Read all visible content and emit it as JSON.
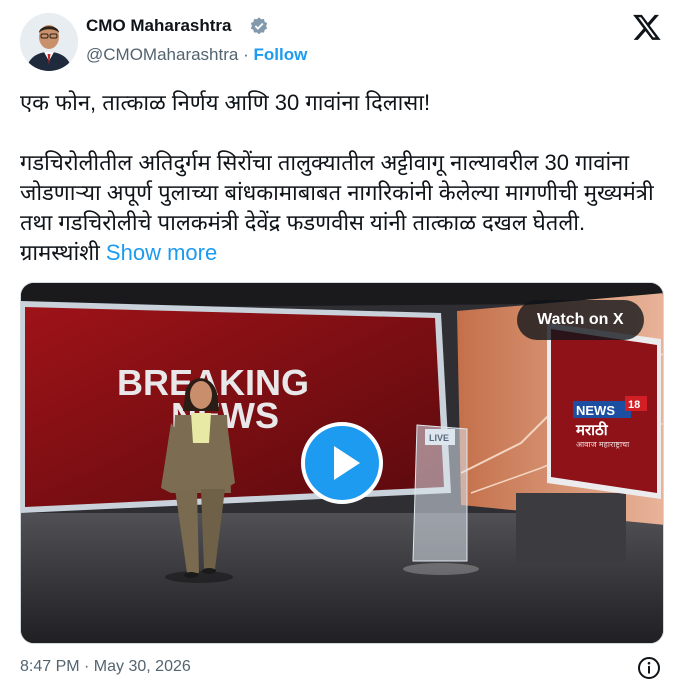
{
  "author": {
    "name": "CMO Maharashtra",
    "handle": "@CMOMaharashtra",
    "separator": "·",
    "follow_label": "Follow",
    "avatar_icon": "person-avatar",
    "verified_icon": "verified-badge-icon"
  },
  "tweet": {
    "text": "एक फोन, तात्काळ निर्णय आणि 30 गावांना दिलासा!\n\nगडचिरोलीतील अतिदुर्गम सिरोंचा तालुक्यातील अट्टीवागू नाल्यावरील 30 गावांना जोडणाऱ्या अपूर्ण पुलाच्या बांधकामाबाबत नागरिकांनी केलेल्या मागणीची मुख्यमंत्री तथा गडचिरोलीचे पालकमंत्री देवेंद्र फडणवीस यांनी तात्काळ दखल घेतली. ग्रामस्थांशी",
    "show_more_label": "Show more"
  },
  "media": {
    "watch_label": "Watch on X",
    "screen_line1": "BREAKING",
    "screen_line2": "NEWS",
    "channel_name": "NEWS",
    "channel_number": "18",
    "channel_language": "मराठी",
    "channel_tagline": "आवाज महाराष्ट्राचा",
    "podium_label": "LIVE",
    "play_icon": "play-icon"
  },
  "footer": {
    "timestamp": "8:47 PM · May 30, 2026",
    "info_icon": "info-icon"
  },
  "colors": {
    "accent": "#1d9bf0",
    "text": "#0f1419",
    "muted": "#536471",
    "breaking_red": "#b4161b"
  }
}
